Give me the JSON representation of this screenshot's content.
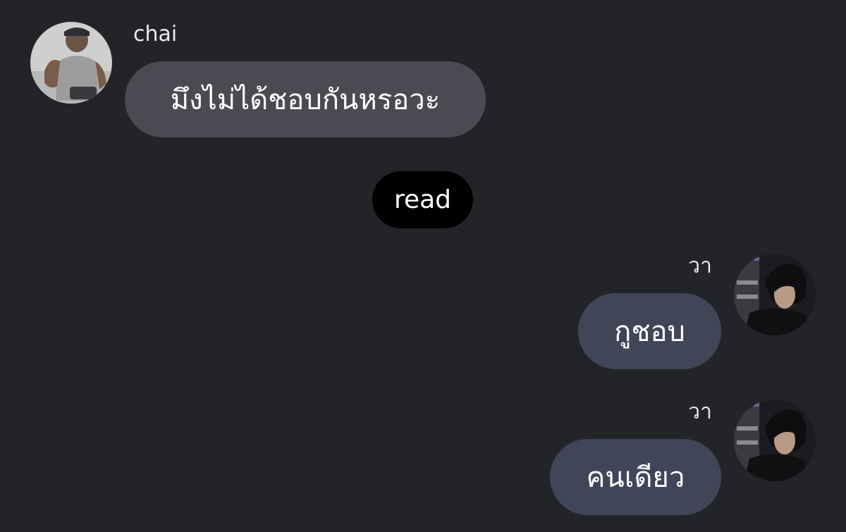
{
  "messages": [
    {
      "sender": "chai",
      "text": "มึงไม่ได้ชอบกันหรอวะ",
      "direction": "incoming"
    },
    {
      "sender": "วา",
      "text": "กูชอบ",
      "direction": "outgoing"
    },
    {
      "sender": "วา",
      "text": "คนเดียว",
      "direction": "outgoing"
    }
  ],
  "read_status": "read",
  "colors": {
    "background": "#232428",
    "incoming_bubble": "#4a4b52",
    "outgoing_bubble": "#404658",
    "read_pill": "#000000"
  }
}
